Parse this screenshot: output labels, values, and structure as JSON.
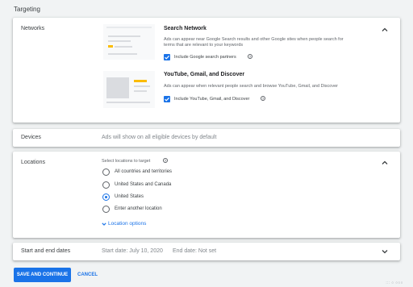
{
  "section_title": "Targeting",
  "networks": {
    "label": "Networks",
    "search": {
      "title": "Search Network",
      "desc_line1": "Ads can appear near Google Search results and other Google sites when people search for",
      "desc_line2": "terms that are relevant to your keywords",
      "checkbox_label": "Include Google search partners",
      "checked": true
    },
    "youtube": {
      "title": "YouTube, Gmail, and Discover",
      "desc": "Ads can appear when relevant people search and browse YouTube, Gmail, and Discover",
      "checkbox_label": "Include YouTube, Gmail, and Discover",
      "checked": true
    },
    "help_glyph": "?",
    "accent": "#1a73e8",
    "thumb_accent": "#fbbc04"
  },
  "devices": {
    "label": "Devices",
    "summary": "Ads will show on all eligible devices by default"
  },
  "locations": {
    "label": "Locations",
    "prompt": "Select locations to target",
    "help_glyph": "?",
    "options": [
      {
        "label": "All countries and territories",
        "selected": false
      },
      {
        "label": "United States and Canada",
        "selected": false
      },
      {
        "label": "United States",
        "selected": true
      },
      {
        "label": "Enter another location",
        "selected": false
      }
    ],
    "location_options_link": "Location options"
  },
  "dates": {
    "label": "Start and end dates",
    "start": "Start date: July 10, 2020",
    "end": "End date: Not set"
  },
  "actions": {
    "save": "SAVE AND CONTINUE",
    "cancel": "CANCEL"
  },
  "corner_text": "::: ○ ○○○"
}
